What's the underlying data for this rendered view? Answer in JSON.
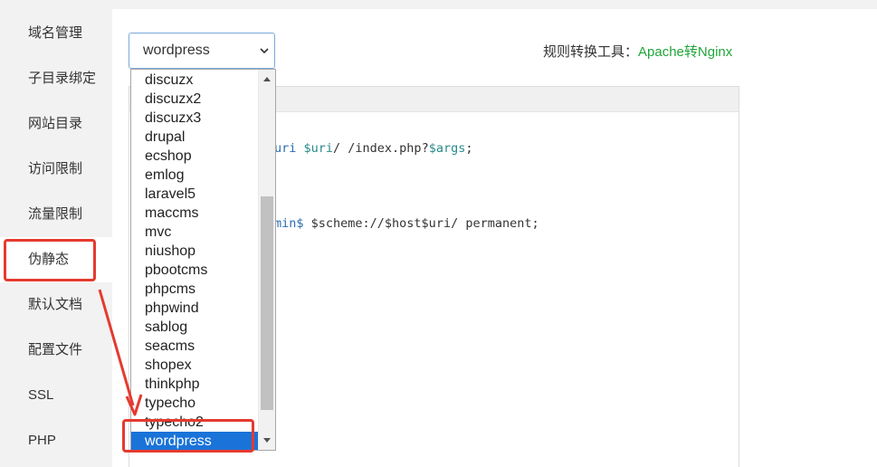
{
  "sidebar": {
    "items": [
      {
        "label": "域名管理"
      },
      {
        "label": "子目录绑定"
      },
      {
        "label": "网站目录"
      },
      {
        "label": "访问限制"
      },
      {
        "label": "流量限制"
      },
      {
        "label": "伪静态",
        "active": true
      },
      {
        "label": "默认文档"
      },
      {
        "label": "配置文件"
      },
      {
        "label": "SSL"
      },
      {
        "label": "PHP"
      }
    ]
  },
  "select": {
    "value": "wordpress",
    "options": [
      "discuzx",
      "discuzx2",
      "discuzx3",
      "drupal",
      "ecshop",
      "emlog",
      "laravel5",
      "maccms",
      "mvc",
      "niushop",
      "pbootcms",
      "phpcms",
      "phpwind",
      "sablog",
      "seacms",
      "shopex",
      "thinkphp",
      "typecho",
      "typecho2",
      "wordpress"
    ]
  },
  "tool": {
    "label": "规则转换工具：",
    "link": "Apache转Nginx"
  },
  "editor": {
    "line1": {
      "kw": "uri ",
      "v1": "$uri",
      "t1": "/ /index.php?",
      "v2": "$args",
      "t2": ";"
    },
    "line2": {
      "kw": "min$",
      "t1": " $scheme://$host$uri/ permanent;"
    }
  },
  "colors": {
    "accent": "#20a53a",
    "selected": "#1a73d9",
    "annotation": "#e53a2f"
  }
}
